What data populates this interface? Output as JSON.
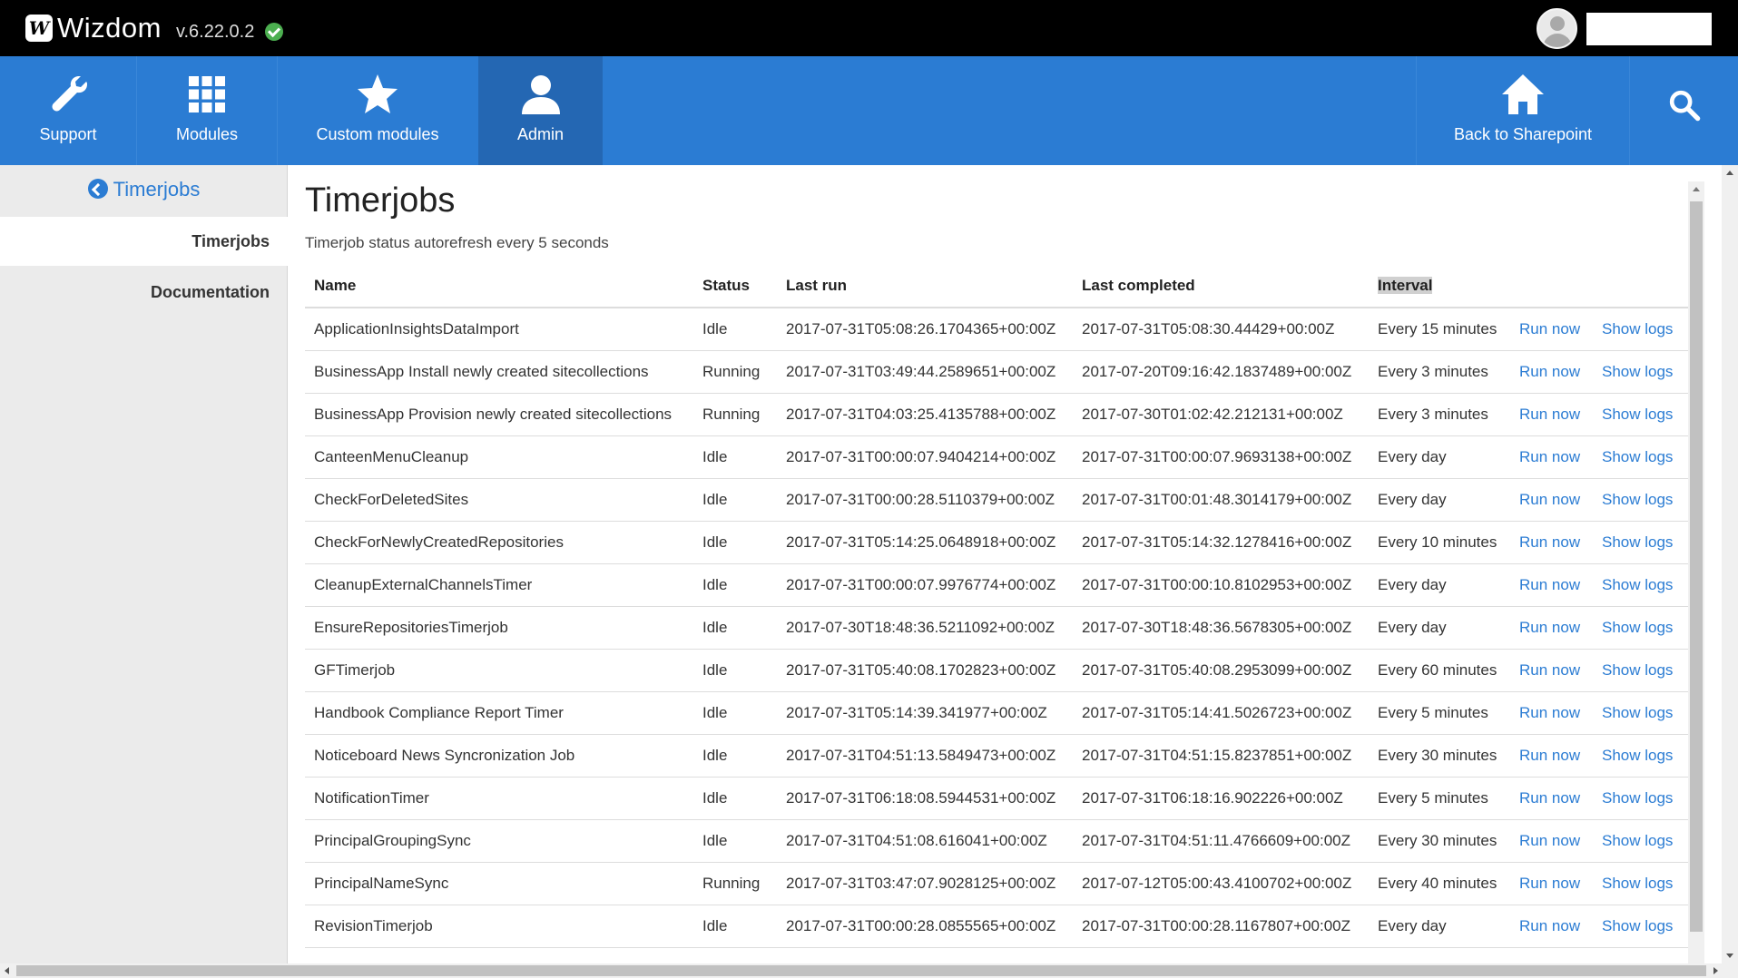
{
  "app": {
    "logo_mark": "W",
    "logo_text": "Wizdom",
    "version": "v.6.22.0.2"
  },
  "nav": {
    "items": [
      {
        "label": "Support",
        "icon": "wrench-icon"
      },
      {
        "label": "Modules",
        "icon": "grid-icon"
      },
      {
        "label": "Custom modules",
        "icon": "star-icon"
      },
      {
        "label": "Admin",
        "icon": "user-icon"
      }
    ],
    "back_label": "Back to Sharepoint",
    "back_icon": "home-icon",
    "search_icon": "search-icon"
  },
  "sidebar": {
    "back_label": "Timerjobs",
    "items": [
      {
        "label": "Timerjobs",
        "active": true
      },
      {
        "label": "Documentation",
        "active": false
      }
    ]
  },
  "main": {
    "title": "Timerjobs",
    "subtitle": "Timerjob status autorefresh every 5 seconds",
    "columns": [
      "Name",
      "Status",
      "Last run",
      "Last completed",
      "Interval"
    ],
    "actions": {
      "run": "Run now",
      "logs": "Show logs"
    },
    "rows": [
      [
        "ApplicationInsightsDataImport",
        "Idle",
        "2017-07-31T05:08:26.1704365+00:00Z",
        "2017-07-31T05:08:30.44429+00:00Z",
        "Every 15 minutes"
      ],
      [
        "BusinessApp Install newly created sitecollections",
        "Running",
        "2017-07-31T03:49:44.2589651+00:00Z",
        "2017-07-20T09:16:42.1837489+00:00Z",
        "Every 3 minutes"
      ],
      [
        "BusinessApp Provision newly created sitecollections",
        "Running",
        "2017-07-31T04:03:25.4135788+00:00Z",
        "2017-07-30T01:02:42.212131+00:00Z",
        "Every 3 minutes"
      ],
      [
        "CanteenMenuCleanup",
        "Idle",
        "2017-07-31T00:00:07.9404214+00:00Z",
        "2017-07-31T00:00:07.9693138+00:00Z",
        "Every day"
      ],
      [
        "CheckForDeletedSites",
        "Idle",
        "2017-07-31T00:00:28.5110379+00:00Z",
        "2017-07-31T00:01:48.3014179+00:00Z",
        "Every day"
      ],
      [
        "CheckForNewlyCreatedRepositories",
        "Idle",
        "2017-07-31T05:14:25.0648918+00:00Z",
        "2017-07-31T05:14:32.1278416+00:00Z",
        "Every 10 minutes"
      ],
      [
        "CleanupExternalChannelsTimer",
        "Idle",
        "2017-07-31T00:00:07.9976774+00:00Z",
        "2017-07-31T00:00:10.8102953+00:00Z",
        "Every day"
      ],
      [
        "EnsureRepositoriesTimerjob",
        "Idle",
        "2017-07-30T18:48:36.5211092+00:00Z",
        "2017-07-30T18:48:36.5678305+00:00Z",
        "Every day"
      ],
      [
        "GFTimerjob",
        "Idle",
        "2017-07-31T05:40:08.1702823+00:00Z",
        "2017-07-31T05:40:08.2953099+00:00Z",
        "Every 60 minutes"
      ],
      [
        "Handbook Compliance Report Timer",
        "Idle",
        "2017-07-31T05:14:39.341977+00:00Z",
        "2017-07-31T05:14:41.5026723+00:00Z",
        "Every 5 minutes"
      ],
      [
        "Noticeboard News Syncronization Job",
        "Idle",
        "2017-07-31T04:51:13.5849473+00:00Z",
        "2017-07-31T04:51:15.8237851+00:00Z",
        "Every 30 minutes"
      ],
      [
        "NotificationTimer",
        "Idle",
        "2017-07-31T06:18:08.5944531+00:00Z",
        "2017-07-31T06:18:16.902226+00:00Z",
        "Every 5 minutes"
      ],
      [
        "PrincipalGroupingSync",
        "Idle",
        "2017-07-31T04:51:08.616041+00:00Z",
        "2017-07-31T04:51:11.4766609+00:00Z",
        "Every 30 minutes"
      ],
      [
        "PrincipalNameSync",
        "Running",
        "2017-07-31T03:47:07.9028125+00:00Z",
        "2017-07-12T05:00:43.4100702+00:00Z",
        "Every 40 minutes"
      ],
      [
        "RevisionTimerjob",
        "Idle",
        "2017-07-31T00:00:28.0855565+00:00Z",
        "2017-07-31T00:00:28.1167807+00:00Z",
        "Every day"
      ]
    ]
  },
  "colors": {
    "brand_blue": "#2b7cd3",
    "nav_active": "#2467b3",
    "topbar": "#000000",
    "status_ok": "#4caf50"
  }
}
